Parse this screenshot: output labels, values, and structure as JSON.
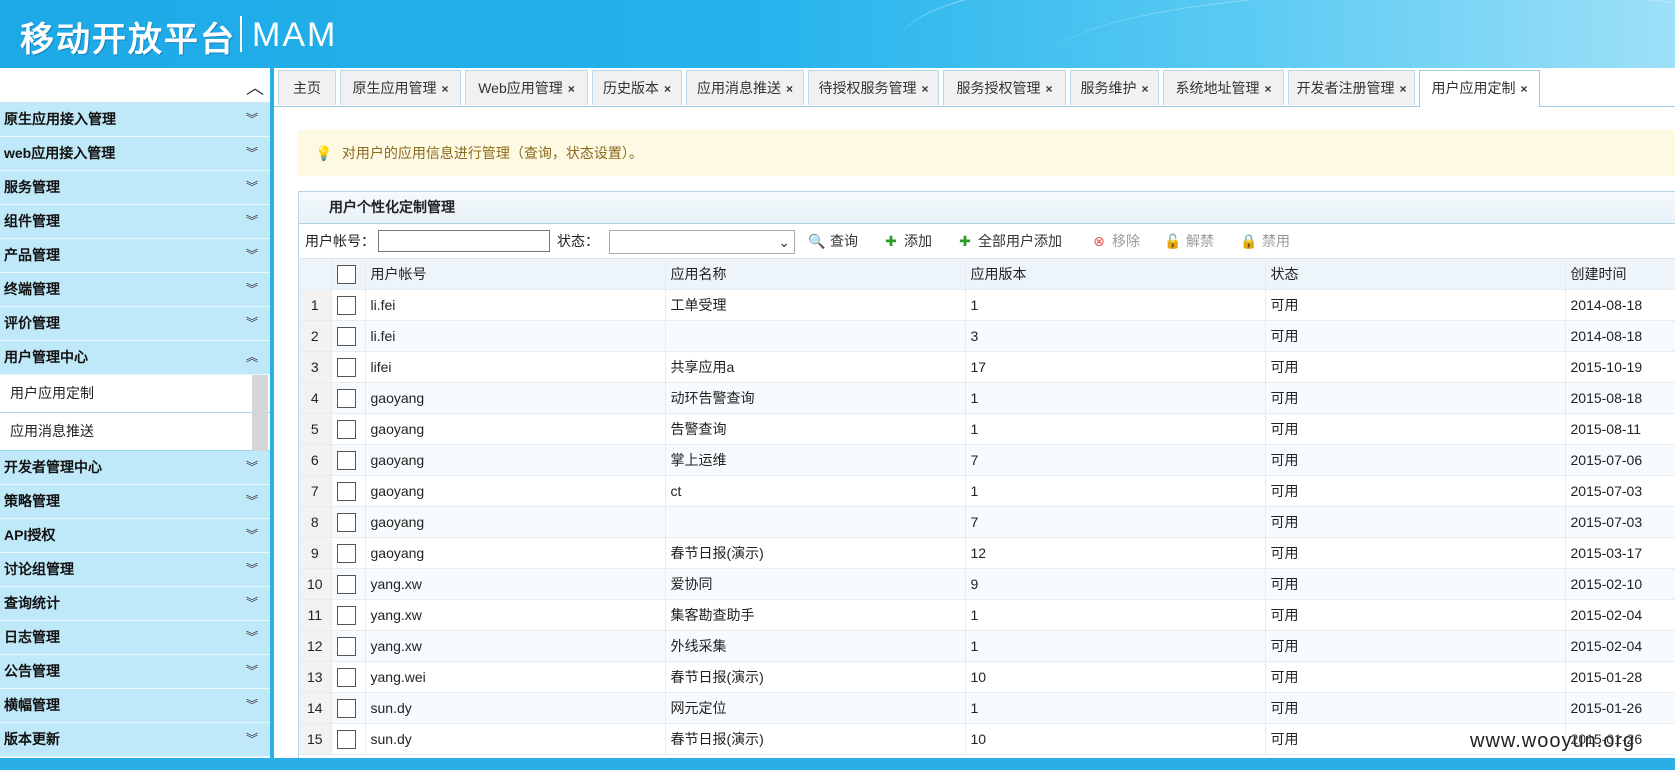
{
  "header": {
    "title_cn": "移动开放平台",
    "title_en": "MAM"
  },
  "sidebar": {
    "collapse_icon": "chevron-up-icon",
    "menus_top": [
      "原生应用接入管理",
      "web应用接入管理",
      "服务管理",
      "组件管理",
      "产品管理",
      "终端管理",
      "评价管理"
    ],
    "expanded_menu": "用户管理中心",
    "sub_items": [
      "用户应用定制",
      "应用消息推送"
    ],
    "menus_bottom": [
      "开发者管理中心",
      "策略管理",
      "API授权",
      "讨论组管理",
      "查询统计",
      "日志管理",
      "公告管理",
      "横幅管理",
      "版本更新"
    ]
  },
  "tabs": [
    {
      "label": "主页",
      "closable": false
    },
    {
      "label": "原生应用管理",
      "closable": true
    },
    {
      "label": "Web应用管理",
      "closable": true
    },
    {
      "label": "历史版本",
      "closable": true
    },
    {
      "label": "应用消息推送",
      "closable": true
    },
    {
      "label": "待授权服务管理",
      "closable": true
    },
    {
      "label": "服务授权管理",
      "closable": true
    },
    {
      "label": "服务维护",
      "closable": true
    },
    {
      "label": "系统地址管理",
      "closable": true
    },
    {
      "label": "开发者注册管理",
      "closable": true
    },
    {
      "label": "用户应用定制",
      "closable": true,
      "active": true
    }
  ],
  "tip": {
    "icon": "lightbulb-icon",
    "text": "对用户的应用信息进行管理（查询，状态设置）。"
  },
  "panel": {
    "title": "用户个性化定制管理",
    "filters": {
      "account_label": "用户帐号：",
      "account_value": "",
      "status_label": "状态：",
      "status_value": ""
    },
    "buttons": {
      "query": "查询",
      "add": "添加",
      "add_all": "全部用户添加",
      "remove": "移除",
      "unban": "解禁",
      "ban": "禁用"
    },
    "columns": [
      "用户帐号",
      "应用名称",
      "应用版本",
      "状态",
      "创建时间"
    ],
    "rows": [
      {
        "n": "1",
        "account": "li.fei",
        "app": "工单受理",
        "ver": "1",
        "status": "可用",
        "created": "2014-08-18"
      },
      {
        "n": "2",
        "account": "li.fei",
        "app": "",
        "ver": "3",
        "status": "可用",
        "created": "2014-08-18"
      },
      {
        "n": "3",
        "account": "lifei",
        "app": "共享应用a",
        "ver": "17",
        "status": "可用",
        "created": "2015-10-19"
      },
      {
        "n": "4",
        "account": "gaoyang",
        "app": "动环告警查询",
        "ver": "1",
        "status": "可用",
        "created": "2015-08-18"
      },
      {
        "n": "5",
        "account": "gaoyang",
        "app": "告警查询",
        "ver": "1",
        "status": "可用",
        "created": "2015-08-11"
      },
      {
        "n": "6",
        "account": "gaoyang",
        "app": "掌上运维",
        "ver": "7",
        "status": "可用",
        "created": "2015-07-06"
      },
      {
        "n": "7",
        "account": "gaoyang",
        "app": "ct",
        "ver": "1",
        "status": "可用",
        "created": "2015-07-03"
      },
      {
        "n": "8",
        "account": "gaoyang",
        "app": "",
        "ver": "7",
        "status": "可用",
        "created": "2015-07-03"
      },
      {
        "n": "9",
        "account": "gaoyang",
        "app": "春节日报(演示)",
        "ver": "12",
        "status": "可用",
        "created": "2015-03-17"
      },
      {
        "n": "10",
        "account": "yang.xw",
        "app": "爱协同",
        "ver": "9",
        "status": "可用",
        "created": "2015-02-10"
      },
      {
        "n": "11",
        "account": "yang.xw",
        "app": "集客勘查助手",
        "ver": "1",
        "status": "可用",
        "created": "2015-02-04"
      },
      {
        "n": "12",
        "account": "yang.xw",
        "app": "外线采集",
        "ver": "1",
        "status": "可用",
        "created": "2015-02-04"
      },
      {
        "n": "13",
        "account": "yang.wei",
        "app": "春节日报(演示)",
        "ver": "10",
        "status": "可用",
        "created": "2015-01-28"
      },
      {
        "n": "14",
        "account": "sun.dy",
        "app": "网元定位",
        "ver": "1",
        "status": "可用",
        "created": "2015-01-26"
      },
      {
        "n": "15",
        "account": "sun.dy",
        "app": "春节日报(演示)",
        "ver": "10",
        "status": "可用",
        "created": "2015-01-26"
      }
    ]
  },
  "watermark": "www.wooyun.org"
}
